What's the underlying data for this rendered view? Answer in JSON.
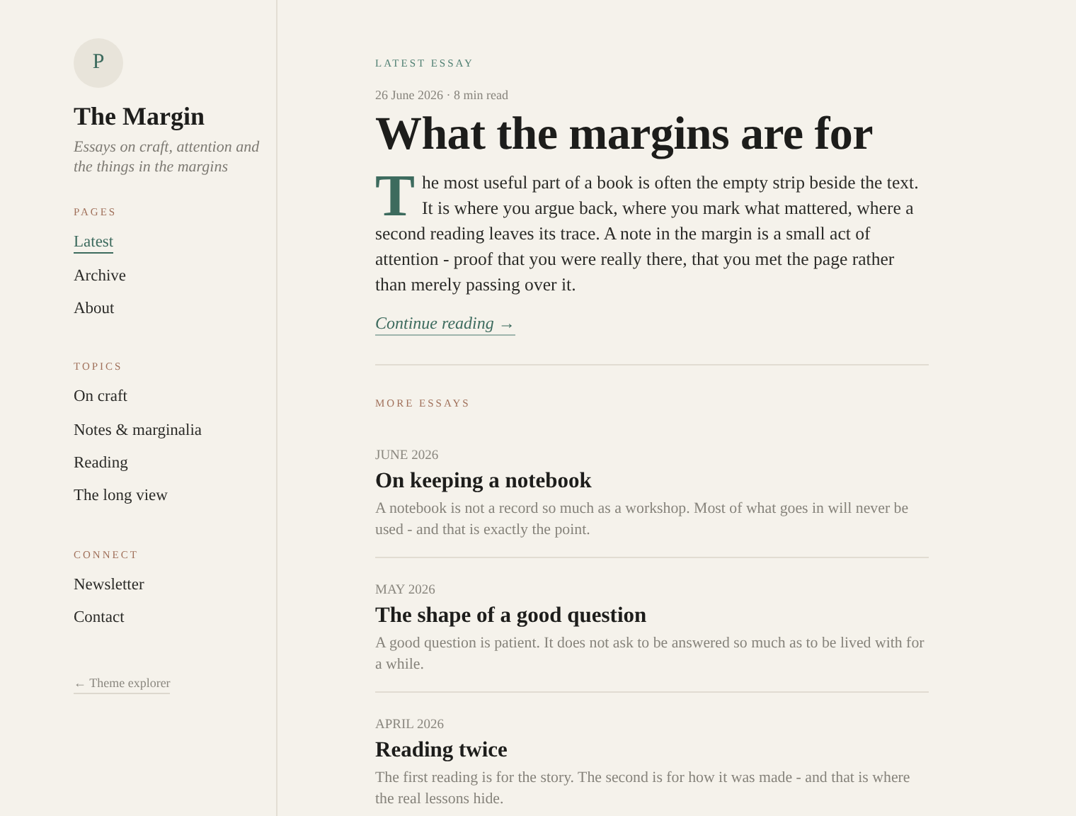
{
  "sidebar": {
    "avatar": "P",
    "title": "The Margin",
    "tagline": "Essays on craft, attention and the things in the margins",
    "sections": [
      {
        "heading": "PAGES",
        "items": [
          {
            "label": "Latest",
            "selected": true
          },
          {
            "label": "Archive",
            "selected": false
          },
          {
            "label": "About",
            "selected": false
          }
        ]
      },
      {
        "heading": "TOPICS",
        "items": [
          {
            "label": "On craft",
            "selected": false
          },
          {
            "label": "Notes & marginalia",
            "selected": false
          },
          {
            "label": "Reading",
            "selected": false
          },
          {
            "label": "The long view",
            "selected": false
          }
        ]
      },
      {
        "heading": "CONNECT",
        "items": [
          {
            "label": "Newsletter",
            "selected": false
          },
          {
            "label": "Contact",
            "selected": false
          }
        ]
      }
    ],
    "footer_link": "← Theme explorer"
  },
  "latest": {
    "eyebrow": "LATEST ESSAY",
    "meta": "26 June 2026 · 8 min read",
    "title": "What the margins are for",
    "drop_cap": "T",
    "text": "he most useful part of a book is often the empty strip beside the text. It is where you argue back, where you mark what mattered, where a second reading leaves its trace. A note in the margin is a small act of attention - proof that you were really there, that you met the page rather than merely passing over it.",
    "link": "Continue reading →"
  },
  "more": {
    "heading": "MORE ESSAYS",
    "essays": [
      {
        "date": "JUNE 2026",
        "title": "On keeping a notebook",
        "summary": "A notebook is not a record so much as a workshop. Most of what goes in will never be used - and that is exactly the point."
      },
      {
        "date": "MAY 2026",
        "title": "The shape of a good question",
        "summary": "A good question is patient. It does not ask to be answered so much as to be lived with for a while."
      },
      {
        "date": "APRIL 2026",
        "title": "Reading twice",
        "summary": "The first reading is for the story. The second is for how it was made - and that is where the real lessons hide."
      }
    ]
  }
}
